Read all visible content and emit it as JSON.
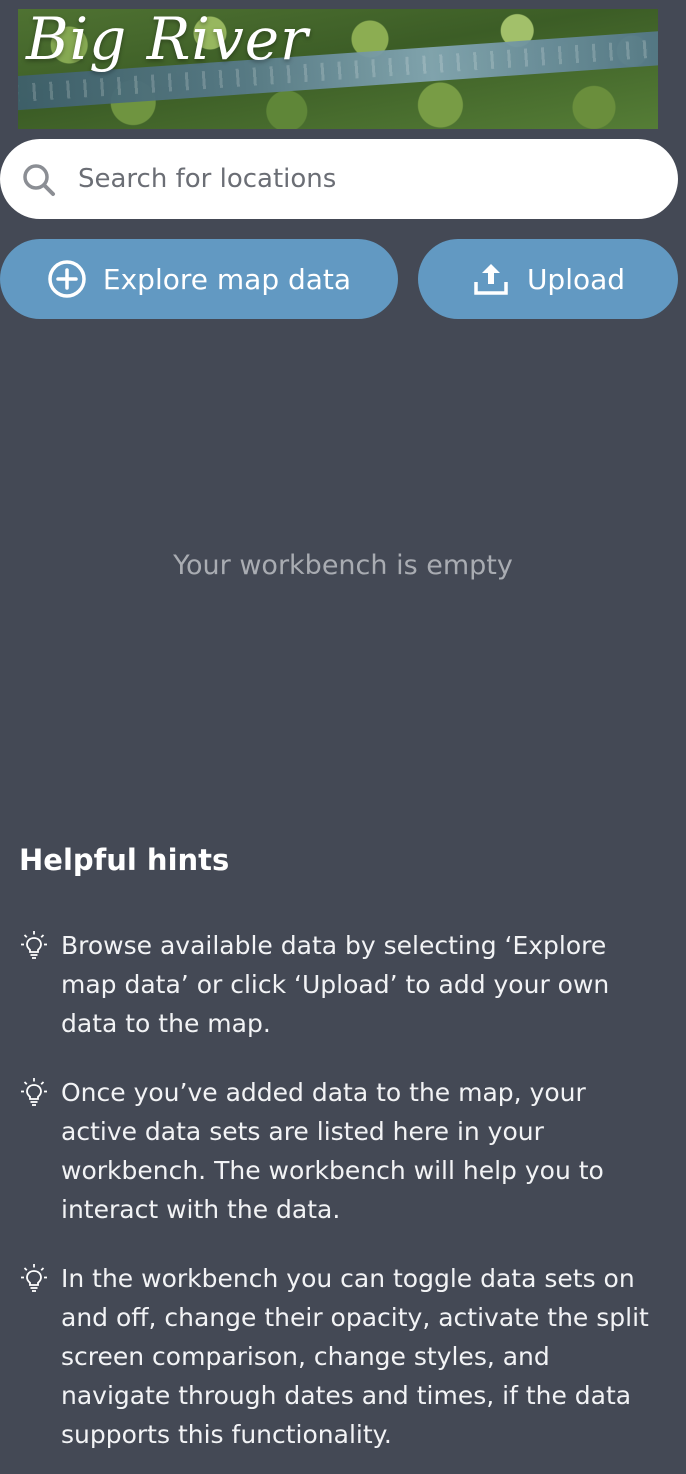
{
  "banner": {
    "title": "Big River"
  },
  "search": {
    "placeholder": "Search for locations"
  },
  "actions": {
    "explore_label": "Explore map data",
    "upload_label": "Upload"
  },
  "workbench": {
    "empty_message": "Your workbench is empty"
  },
  "hints": {
    "title": "Helpful hints",
    "items": [
      "Browse available data by selecting ‘Explore map data’ or click ‘Upload’ to add your own data to the map.",
      "Once you’ve added data to the map, your active data sets are listed here in your workbench. The workbench will help you to interact with the data.",
      "In the workbench you can toggle data sets on and off, change their opacity, activate the split screen comparison, change styles, and navigate through dates and times, if the data supports this functionality."
    ]
  },
  "colors": {
    "background": "#444955",
    "button": "#6299c2",
    "search_background": "#ffffff"
  },
  "icons": {
    "search": "search-icon",
    "explore": "plus-circle-icon",
    "upload": "upload-icon",
    "hint": "lightbulb-icon"
  }
}
